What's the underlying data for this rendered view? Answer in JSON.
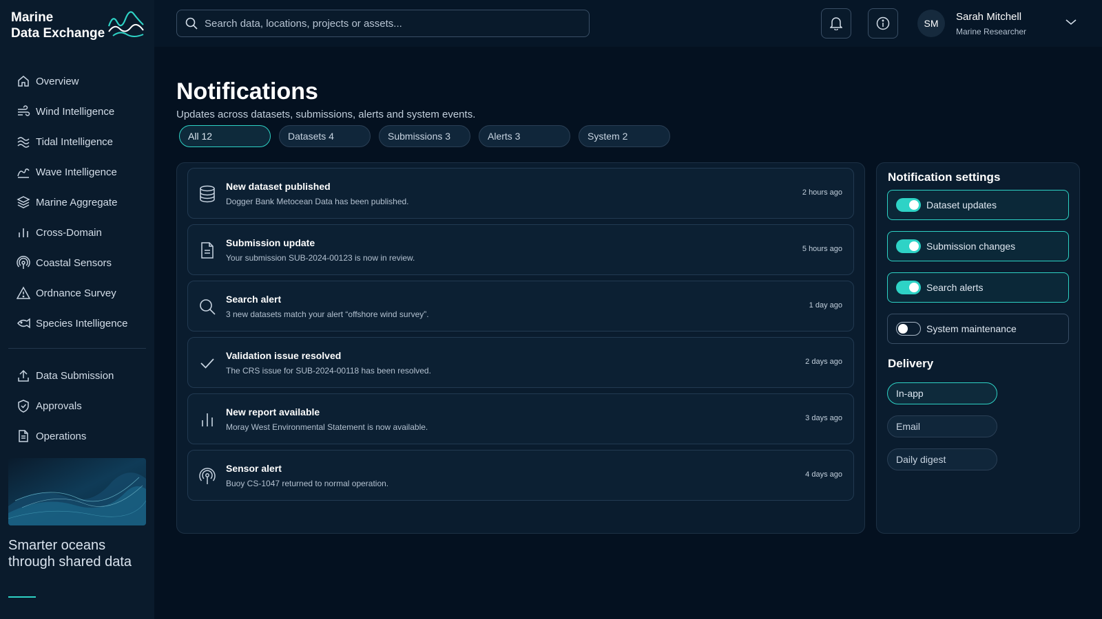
{
  "brand": {
    "line1": "Marine",
    "line2": "Data Exchange"
  },
  "nav": {
    "primary": [
      {
        "label": "Overview",
        "icon": "home-icon"
      },
      {
        "label": "Wind Intelligence",
        "icon": "wind-icon"
      },
      {
        "label": "Tidal Intelligence",
        "icon": "tide-icon"
      },
      {
        "label": "Wave Intelligence",
        "icon": "wave-icon"
      },
      {
        "label": "Marine Aggregate",
        "icon": "layers-icon"
      },
      {
        "label": "Cross-Domain",
        "icon": "bar-chart-icon"
      },
      {
        "label": "Coastal Sensors",
        "icon": "sensor-icon"
      },
      {
        "label": "Ordnance Survey",
        "icon": "warning-icon"
      },
      {
        "label": "Species Intelligence",
        "icon": "fish-icon"
      }
    ],
    "secondary": [
      {
        "label": "Data Submission",
        "icon": "upload-icon"
      },
      {
        "label": "Approvals",
        "icon": "shield-check-icon"
      },
      {
        "label": "Operations",
        "icon": "document-icon"
      }
    ]
  },
  "tagline": "Smarter oceans through shared data",
  "header": {
    "search_placeholder": "Search data, locations, projects or assets...",
    "user": {
      "initials": "SM",
      "name": "Sarah Mitchell",
      "role": "Marine Researcher"
    }
  },
  "page": {
    "title": "Notifications",
    "subtitle": "Updates across datasets, submissions, alerts and system events."
  },
  "filters": [
    {
      "label": "All 12",
      "active": true
    },
    {
      "label": "Datasets 4",
      "active": false
    },
    {
      "label": "Submissions 3",
      "active": false
    },
    {
      "label": "Alerts 3",
      "active": false
    },
    {
      "label": "System 2",
      "active": false
    }
  ],
  "notifications": [
    {
      "title": "New dataset published",
      "desc": "Dogger Bank Metocean Data has been published.",
      "time": "2 hours ago",
      "icon": "database-icon"
    },
    {
      "title": "Submission update",
      "desc": "Your submission SUB-2024-00123 is now in review.",
      "time": "5 hours ago",
      "icon": "document-icon"
    },
    {
      "title": "Search alert",
      "desc": "3 new datasets match your alert “offshore wind survey”.",
      "time": "1 day ago",
      "icon": "search-icon"
    },
    {
      "title": "Validation issue resolved",
      "desc": "The CRS issue for SUB-2024-00118 has been resolved.",
      "time": "2 days ago",
      "icon": "check-icon"
    },
    {
      "title": "New report available",
      "desc": "Moray West Environmental Statement is now available.",
      "time": "3 days ago",
      "icon": "bar-chart-icon"
    },
    {
      "title": "Sensor alert",
      "desc": "Buoy CS-1047 returned to normal operation.",
      "time": "4 days ago",
      "icon": "sensor-icon"
    }
  ],
  "settings": {
    "title": "Notification settings",
    "toggles": [
      {
        "label": "Dataset updates",
        "on": true
      },
      {
        "label": "Submission changes",
        "on": true
      },
      {
        "label": "Search alerts",
        "on": true
      },
      {
        "label": "System maintenance",
        "on": false
      }
    ],
    "delivery_title": "Delivery",
    "delivery": [
      {
        "label": "In-app",
        "active": true
      },
      {
        "label": "Email",
        "active": false
      },
      {
        "label": "Daily digest",
        "active": false
      }
    ]
  },
  "colors": {
    "accent": "#2ed3c6",
    "background": "#041120",
    "panel": "#0a1c2e"
  }
}
